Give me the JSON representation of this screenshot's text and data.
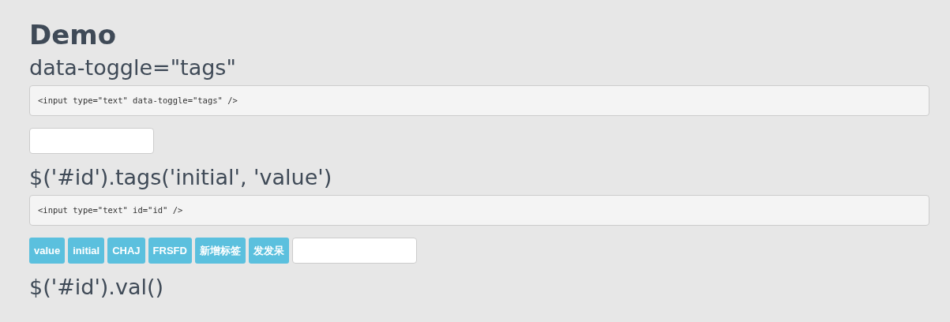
{
  "title": "Demo",
  "sections": [
    {
      "heading": "data-toggle=\"tags\"",
      "code": "<input type=\"text\" data-toggle=\"tags\" />",
      "demo": {
        "kind": "input"
      }
    },
    {
      "heading": "$('#id').tags('initial', 'value')",
      "code": "<input type=\"text\" id=\"id\" />",
      "demo": {
        "kind": "tags",
        "tags": [
          "value",
          "initial",
          "CHAJ",
          "FRSFD",
          "新增标签",
          "发发呆"
        ]
      }
    },
    {
      "heading": "$('#id').val()"
    }
  ]
}
